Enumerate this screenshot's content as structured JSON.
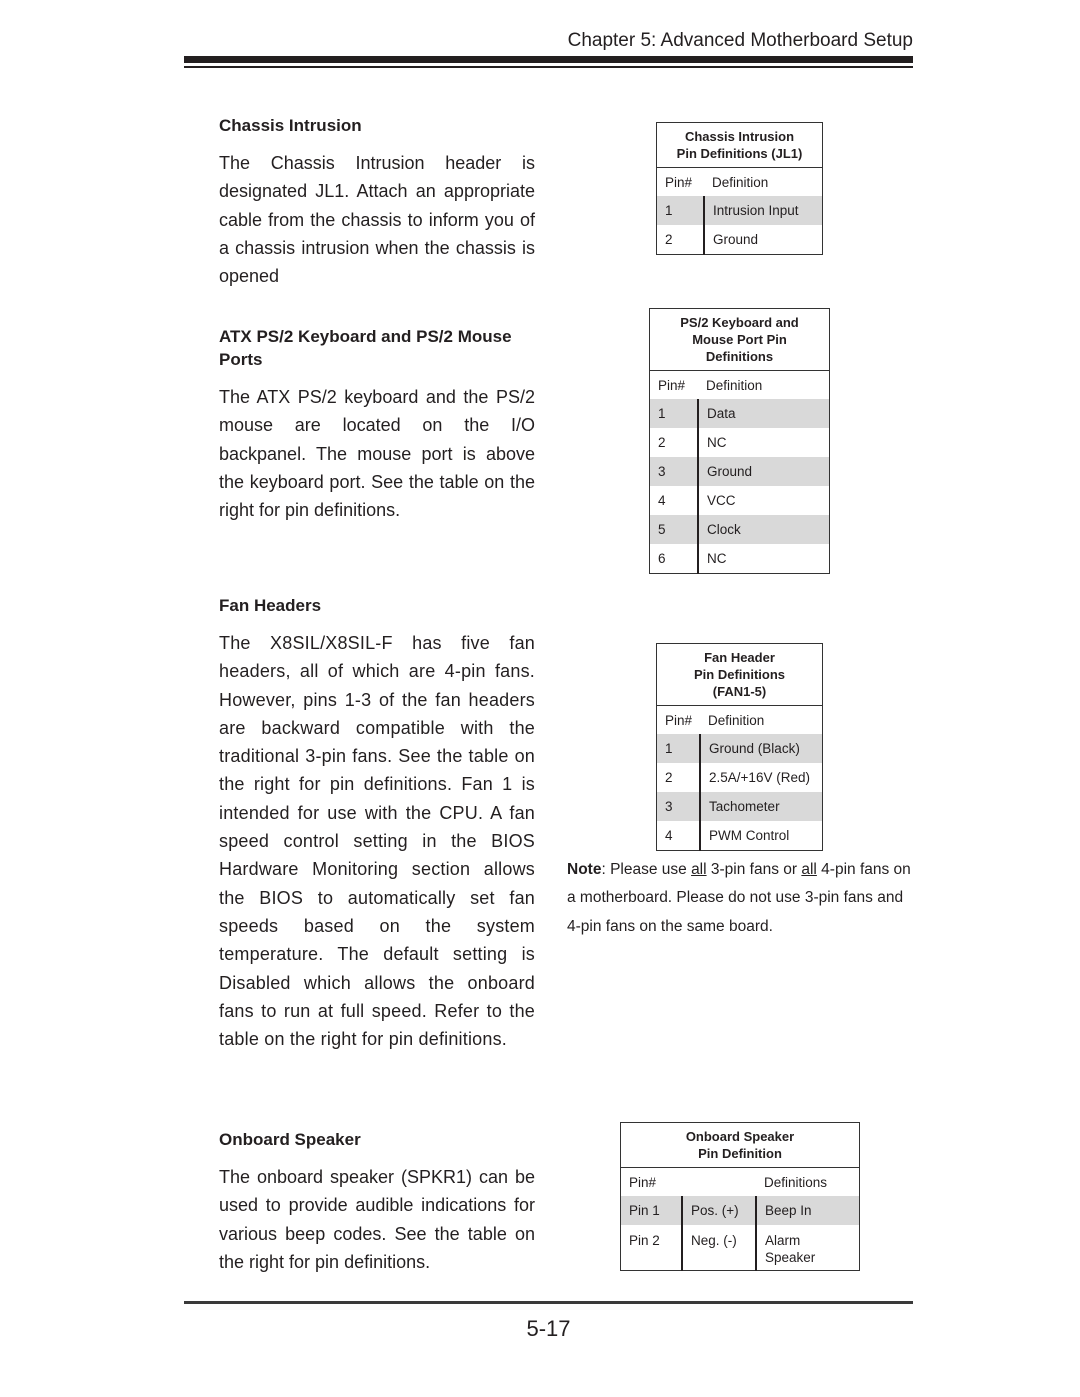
{
  "header": {
    "chapter_title": "Chapter 5: Advanced Motherboard Setup"
  },
  "sections": {
    "chassis": {
      "heading": "Chassis Intrusion",
      "body": "The Chassis Intrusion header is designated JL1. Attach an appropriate cable from the chassis to inform you of a chassis intrusion when the chassis is opened"
    },
    "ps2": {
      "heading": "ATX PS/2 Keyboard and PS/2 Mouse Ports",
      "body": "The ATX PS/2 keyboard and the PS/2 mouse are located on the I/O backpanel. The mouse port is above the keyboard port. See the table on the right for pin definitions."
    },
    "fan": {
      "heading": "Fan Headers",
      "body": "The X8SIL/X8SIL-F has five fan headers, all of which are 4-pin fans. However, pins 1-3 of the fan headers are backward compatible with the traditional 3-pin fans. See the table on the right for pin definitions. Fan 1 is intended for use with the CPU. A fan speed control setting in the BIOS Hardware Monitoring section allows the BIOS to automatically set fan speeds based on the system temperature. The default setting is Disabled which allows the onboard fans to run at full speed. Refer to the table on the right for pin definitions."
    },
    "speaker": {
      "heading": "Onboard Speaker",
      "body": "The onboard speaker (SPKR1) can be used to provide audible indications for various beep codes. See the table on the right for pin definitions."
    }
  },
  "tables": {
    "chassis": {
      "title_line1": "Chassis Intrusion",
      "title_line2": "Pin Definitions (JL1)",
      "col_pin": "Pin#",
      "col_def": "Definition",
      "rows": [
        {
          "pin": "1",
          "def": "Intrusion Input"
        },
        {
          "pin": "2",
          "def": "Ground"
        }
      ]
    },
    "ps2": {
      "title_line1": "PS/2 Keyboard and",
      "title_line2": "Mouse Port Pin",
      "title_line3": "Definitions",
      "col_pin": "Pin#",
      "col_def": "Definition",
      "rows": [
        {
          "pin": "1",
          "def": "Data"
        },
        {
          "pin": "2",
          "def": "NC"
        },
        {
          "pin": "3",
          "def": "Ground"
        },
        {
          "pin": "4",
          "def": "VCC"
        },
        {
          "pin": "5",
          "def": "Clock"
        },
        {
          "pin": "6",
          "def": "NC"
        }
      ]
    },
    "fan": {
      "title_line1": "Fan Header",
      "title_line2": "Pin Definitions",
      "title_line3": "(FAN1-5)",
      "col_pin": "Pin#",
      "col_def": "Definition",
      "rows": [
        {
          "pin": "1",
          "def": "Ground (Black)"
        },
        {
          "pin": "2",
          "def": "2.5A/+16V (Red)"
        },
        {
          "pin": "3",
          "def": "Tachometer"
        },
        {
          "pin": "4",
          "def": "PWM Control"
        }
      ]
    },
    "speaker": {
      "title_line1": "Onboard Speaker",
      "title_line2": "Pin Definition",
      "col_pin": "Pin#",
      "col_def": "Definitions",
      "rows": [
        {
          "pin": "Pin 1",
          "pol": "Pos. (+)",
          "def": "Beep In"
        },
        {
          "pin": "Pin 2",
          "pol": "Neg. (-)",
          "def_line1": "Alarm",
          "def_line2": "Speaker"
        }
      ]
    }
  },
  "note": {
    "label": "Note",
    "part1": ": Please use ",
    "all1": "all",
    "part2": " 3-pin fans or ",
    "all2": "all",
    "part3": " 4-pin fans on a motherboard. Please do not use 3-pin fans and 4-pin fans on the same board."
  },
  "footer": {
    "page_number": "5-17"
  }
}
